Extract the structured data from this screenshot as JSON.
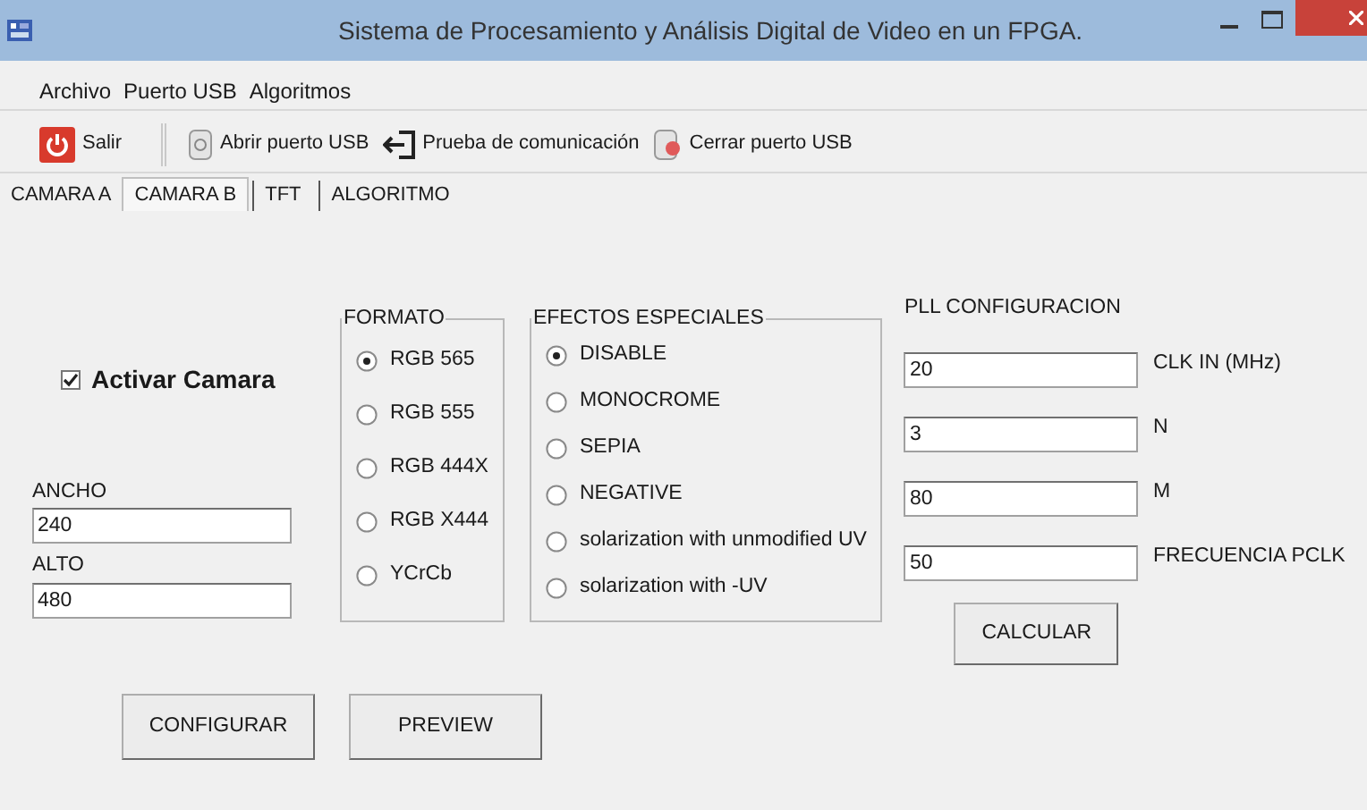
{
  "window": {
    "title": "Sistema de Procesamiento y Análisis Digital de Video en un FPGA."
  },
  "menu": [
    "Archivo",
    "Puerto USB",
    "Algoritmos"
  ],
  "toolbar": [
    {
      "label": "Salir",
      "kind": "power"
    },
    {
      "label": "Abrir puerto USB",
      "kind": "usb-open"
    },
    {
      "label": "Prueba de comunicación",
      "kind": "test"
    },
    {
      "label": "Cerrar puerto USB",
      "kind": "usb-close"
    }
  ],
  "tabs": [
    {
      "label": "CAMARA A",
      "selected": false
    },
    {
      "label": "CAMARA B",
      "selected": true
    },
    {
      "label": "TFT",
      "selected": false
    },
    {
      "label": "ALGORITMO",
      "selected": false
    }
  ],
  "camera": {
    "label": "Activar Camara",
    "checked": true
  },
  "fields": [
    {
      "label": "ANCHO",
      "value": "240"
    },
    {
      "label": "ALTO",
      "value": "480"
    }
  ],
  "formato": {
    "title": "FORMATO",
    "options": [
      {
        "label": "RGB 565",
        "selected": true
      },
      {
        "label": "RGB 555",
        "selected": false
      },
      {
        "label": "RGB 444X",
        "selected": false
      },
      {
        "label": "RGB X444",
        "selected": false
      },
      {
        "label": "YCrCb",
        "selected": false
      }
    ]
  },
  "efectos": {
    "title": "EFECTOS ESPECIALES",
    "options": [
      {
        "label": "DISABLE",
        "selected": true
      },
      {
        "label": "MONOCROME",
        "selected": false
      },
      {
        "label": "SEPIA",
        "selected": false
      },
      {
        "label": "NEGATIVE",
        "selected": false
      },
      {
        "label": "solarization with unmodified UV",
        "selected": false
      },
      {
        "label": "solarization with -UV",
        "selected": false
      }
    ]
  },
  "pll": {
    "title": "PLL CONFIGURACION",
    "fields": [
      {
        "value": "20",
        "label": "CLK IN (MHz)"
      },
      {
        "value": "3",
        "label": "N"
      },
      {
        "value": "80",
        "label": "M"
      },
      {
        "value": "50",
        "label": "FRECUENCIA PCLK"
      }
    ],
    "button": "CALCULAR"
  },
  "buttons": [
    "CONFIGURAR",
    "PREVIEW"
  ]
}
